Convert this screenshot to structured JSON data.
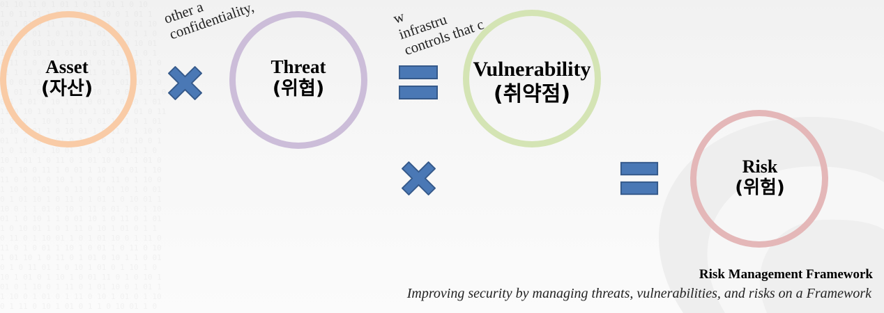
{
  "fragments": {
    "left_lines": [
      "other a",
      "confidentiality,"
    ],
    "right_lines": [
      "w",
      "infrastru",
      "controls that c"
    ]
  },
  "nodes": {
    "asset": {
      "en": "Asset",
      "ko": "(자산)",
      "color": "#f9cba6"
    },
    "threat": {
      "en": "Threat",
      "ko": "(위협)",
      "color": "#ccbdd9"
    },
    "vulnerability": {
      "en": "Vulnerability",
      "ko": "(취약점)",
      "color": "#d4e4b4"
    },
    "risk": {
      "en": "Risk",
      "ko": "(위험)",
      "color": "#e4b7b8"
    }
  },
  "operators": {
    "multiply_icon": "multiply-icon",
    "equals_icon": "equals-icon",
    "fill_color": "#4a78b5",
    "stroke_color": "#35598a"
  },
  "caption": {
    "title": "Risk Management Framework",
    "subtitle": "Improving security by managing threats, vulnerabilities, and risks on a Framework"
  }
}
